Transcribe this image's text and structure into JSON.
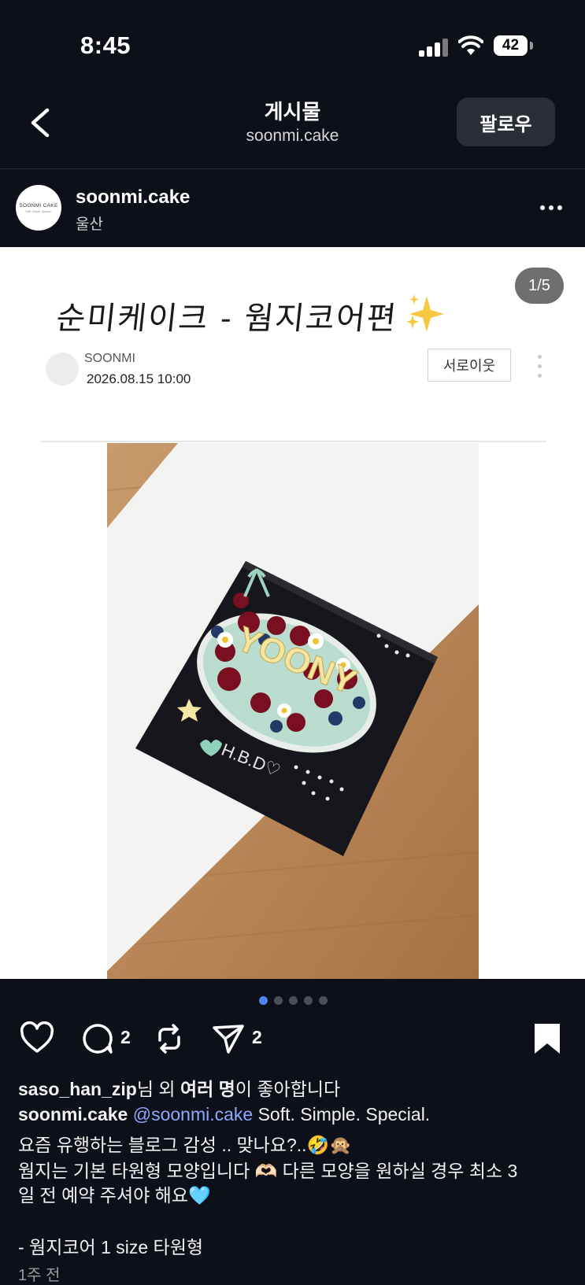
{
  "status": {
    "time": "8:45",
    "battery": "42"
  },
  "header": {
    "title": "게시물",
    "subtitle": "soonmi.cake",
    "follow_label": "팔로우"
  },
  "profile": {
    "name": "soonmi.cake",
    "location": "울산",
    "avatar_text": "SOONMI CAKE",
    "avatar_subtext": "Soft. Simple. Special."
  },
  "post": {
    "counter": "1/5",
    "blog_title": "순미케이크 - 웜지코어편",
    "author": "SOONMI",
    "date": "2026.08.15 10:00",
    "neighbor_label": "서로이웃",
    "photo_lettering": {
      "name": "YOONY",
      "message": "H.B.D♡"
    }
  },
  "carousel": {
    "total": 5,
    "active": 0
  },
  "actions": {
    "comments": "2",
    "shares": "2"
  },
  "likes": {
    "user": "saso_han_zip",
    "text1": "님 외 ",
    "bold": "여러 명",
    "text2": "이 좋아합니다"
  },
  "caption": {
    "user": "soonmi.cake",
    "mention": "@soonmi.cake",
    "line1_text": " Soft. Simple. Special.",
    "line2": "요즘 유행하는 블로그 감성 .. 맞나요?..🤣🙊",
    "line3": "웜지는 기본 타원형 모양입니다 🫶🏻 다른 모양을 원하실 경우 최소 3",
    "line4": "일 전 예약 주셔야 해요🩵",
    "line5": "- 웜지코어 1 size 타원형",
    "line6": "1주 전"
  },
  "colors": {
    "background": "#0d1018",
    "follow_button": "#2a2e37",
    "active_dot": "#4f84f7",
    "mention": "#8fa9ff"
  }
}
